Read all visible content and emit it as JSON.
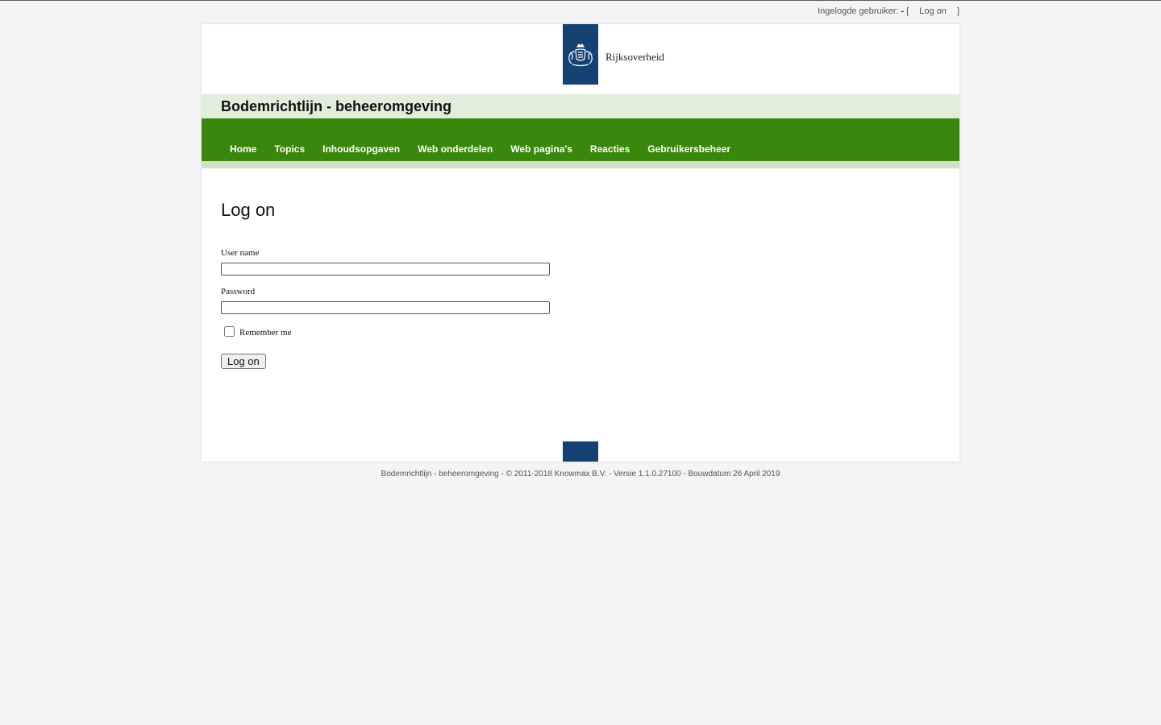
{
  "topbar": {
    "logged_in_label": "Ingelogde gebruiker:",
    "dash": "-",
    "open_bracket": "[",
    "logon_link": "Log on",
    "close_bracket": "]"
  },
  "header": {
    "logo_text": "Rijksoverheid",
    "site_title": "Bodemrichtlijn - beheeromgeving",
    "colors": {
      "logo_blue": "#154273",
      "nav_green": "#39870c",
      "title_band": "#e1eedb"
    }
  },
  "nav": {
    "items": [
      {
        "label": "Home"
      },
      {
        "label": "Topics"
      },
      {
        "label": "Inhoudsopgaven"
      },
      {
        "label": "Web onderdelen"
      },
      {
        "label": "Web pagina's"
      },
      {
        "label": "Reacties"
      },
      {
        "label": "Gebruikersbeheer"
      }
    ]
  },
  "form": {
    "heading": "Log on",
    "username_label": "User name",
    "username_value": "",
    "password_label": "Password",
    "password_value": "",
    "remember_label": "Remember me",
    "remember_checked": false,
    "submit_label": "Log on"
  },
  "footer": {
    "text": "Bodemrichtlijn - beheeromgeving - © 2011-2018 Knowmax B.V. - Versie 1.1.0.27100 - Bouwdatum 26 April 2019"
  }
}
